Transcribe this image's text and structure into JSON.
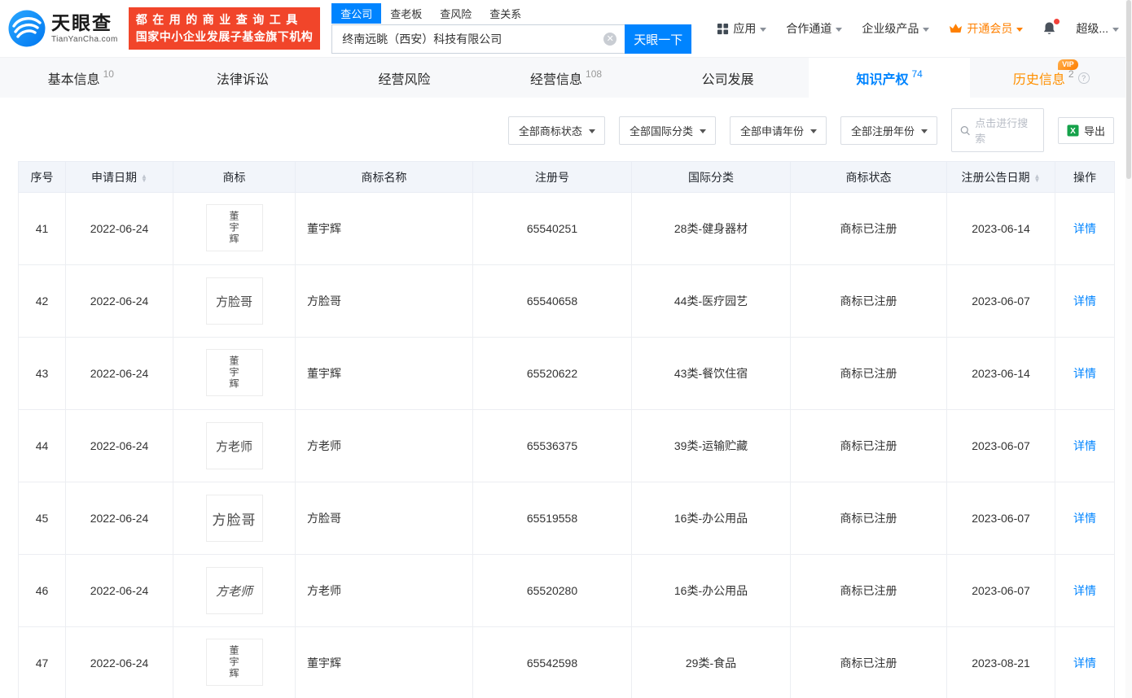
{
  "brand": {
    "name": "天眼查",
    "domain": "TianYanCha.com",
    "banner_line1": "都在用的商业查询工具",
    "banner_line2": "国家中小企业发展子基金旗下机构"
  },
  "search": {
    "tabs": [
      "查公司",
      "查老板",
      "查风险",
      "查关系"
    ],
    "active_tab": "查公司",
    "value": "终南远眺（西安）科技有限公司",
    "button_label": "天眼一下"
  },
  "top_menu": {
    "apps": "应用",
    "partner": "合作通道",
    "enterprise": "企业级产品",
    "member": "开通会员",
    "account": "超级..."
  },
  "labels": {
    "vip": "VIP"
  },
  "page_tabs": [
    {
      "key": "basic-info",
      "label": "基本信息",
      "count": "10",
      "active": false,
      "vip": false
    },
    {
      "key": "legal",
      "label": "法律诉讼",
      "count": "",
      "active": false,
      "vip": false
    },
    {
      "key": "operating-risk",
      "label": "经营风险",
      "count": "",
      "active": false,
      "vip": false
    },
    {
      "key": "business-info",
      "label": "经营信息",
      "count": "108",
      "active": false,
      "vip": false
    },
    {
      "key": "development",
      "label": "公司发展",
      "count": "",
      "active": false,
      "vip": false
    },
    {
      "key": "ip",
      "label": "知识产权",
      "count": "74",
      "active": true,
      "vip": false
    },
    {
      "key": "history",
      "label": "历史信息",
      "count": "2",
      "active": false,
      "vip": true
    }
  ],
  "filters": {
    "dropdowns": [
      {
        "key": "trademark-status",
        "label": "全部商标状态"
      },
      {
        "key": "intl-class",
        "label": "全部国际分类"
      },
      {
        "key": "apply-year",
        "label": "全部申请年份"
      },
      {
        "key": "register-year",
        "label": "全部注册年份"
      }
    ],
    "search_placeholder": "点击进行搜索",
    "export_label": "导出"
  },
  "table": {
    "headers": [
      {
        "key": "index",
        "label": "序号",
        "sortable": false
      },
      {
        "key": "apply-date",
        "label": "申请日期",
        "sortable": true
      },
      {
        "key": "mark",
        "label": "商标",
        "sortable": false
      },
      {
        "key": "mark-name",
        "label": "商标名称",
        "sortable": false
      },
      {
        "key": "reg-no",
        "label": "注册号",
        "sortable": false
      },
      {
        "key": "intl-class",
        "label": "国际分类",
        "sortable": false
      },
      {
        "key": "status",
        "label": "商标状态",
        "sortable": false
      },
      {
        "key": "pub-date",
        "label": "注册公告日期",
        "sortable": true
      },
      {
        "key": "action",
        "label": "操作",
        "sortable": false
      }
    ],
    "rows": [
      {
        "index": "41",
        "apply_date": "2022-06-24",
        "mark": {
          "text": "董宇辉",
          "style": "seal-vertical"
        },
        "mark_name": "董宇辉",
        "reg_no": "65540251",
        "intl_class": "28类-健身器材",
        "status": "商标已注册",
        "pub_date": "2023-06-14",
        "action": "详情"
      },
      {
        "index": "42",
        "apply_date": "2022-06-24",
        "mark": {
          "text": "方脸哥",
          "style": "regular"
        },
        "mark_name": "方脸哥",
        "reg_no": "65540658",
        "intl_class": "44类-医疗园艺",
        "status": "商标已注册",
        "pub_date": "2023-06-07",
        "action": "详情"
      },
      {
        "index": "43",
        "apply_date": "2022-06-24",
        "mark": {
          "text": "董宇辉",
          "style": "seal-vertical"
        },
        "mark_name": "董宇辉",
        "reg_no": "65520622",
        "intl_class": "43类-餐饮住宿",
        "status": "商标已注册",
        "pub_date": "2023-06-14",
        "action": "详情"
      },
      {
        "index": "44",
        "apply_date": "2022-06-24",
        "mark": {
          "text": "方老师",
          "style": "regular"
        },
        "mark_name": "方老师",
        "reg_no": "65536375",
        "intl_class": "39类-运输贮藏",
        "status": "商标已注册",
        "pub_date": "2023-06-07",
        "action": "详情"
      },
      {
        "index": "45",
        "apply_date": "2022-06-24",
        "mark": {
          "text": "方脸哥",
          "style": "large"
        },
        "mark_name": "方脸哥",
        "reg_no": "65519558",
        "intl_class": "16类-办公用品",
        "status": "商标已注册",
        "pub_date": "2023-06-07",
        "action": "详情"
      },
      {
        "index": "46",
        "apply_date": "2022-06-24",
        "mark": {
          "text": "方老师",
          "style": "script"
        },
        "mark_name": "方老师",
        "reg_no": "65520280",
        "intl_class": "16类-办公用品",
        "status": "商标已注册",
        "pub_date": "2023-06-07",
        "action": "详情"
      },
      {
        "index": "47",
        "apply_date": "2022-06-24",
        "mark": {
          "text": "董宇辉",
          "style": "seal-vertical"
        },
        "mark_name": "董宇辉",
        "reg_no": "65542598",
        "intl_class": "29类-食品",
        "status": "商标已注册",
        "pub_date": "2023-08-21",
        "action": "详情"
      }
    ]
  }
}
